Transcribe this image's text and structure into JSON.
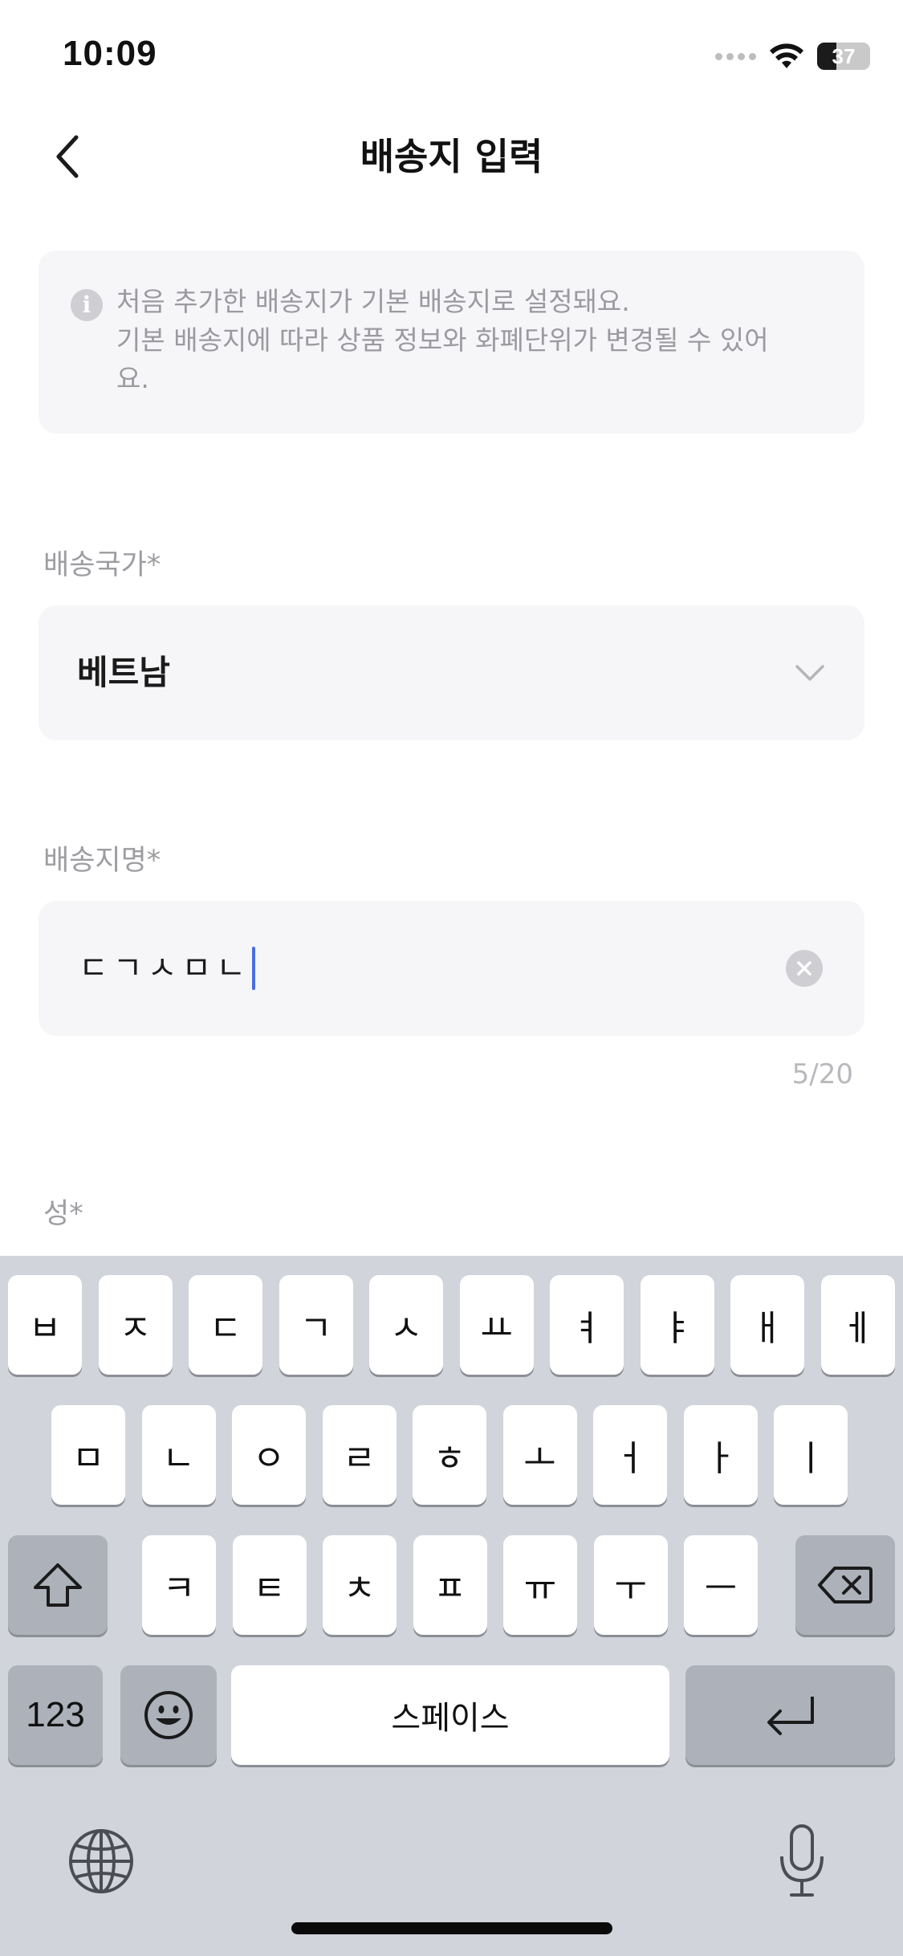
{
  "status_bar": {
    "time": "10:09",
    "battery": "37",
    "battery_level": 0.37,
    "signal_icon": "cellular-dots-icon",
    "wifi_icon": "wifi-icon"
  },
  "nav": {
    "title": "배송지 입력",
    "back_icon": "chevron-left-icon"
  },
  "info": {
    "icon": "info-icon",
    "text": "처음 추가한 배송지가 기본 배송지로 설정돼요.\n기본 배송지에 따라 상품 정보와 화폐단위가 변경될 수 있어\n요."
  },
  "country_field": {
    "label": "배송국가*",
    "value": "베트남",
    "icon": "chevron-down-icon"
  },
  "name_field": {
    "label": "배송지명*",
    "value": "ㄷㄱㅅㅁㄴ",
    "counter": "5/20",
    "clear_icon": "clear-icon"
  },
  "surname_field": {
    "label": "성*"
  },
  "keyboard": {
    "row1": [
      "ㅂ",
      "ㅈ",
      "ㄷ",
      "ㄱ",
      "ㅅ",
      "ㅛ",
      "ㅕ",
      "ㅑ",
      "ㅐ",
      "ㅔ"
    ],
    "row2": [
      "ㅁ",
      "ㄴ",
      "ㅇ",
      "ㄹ",
      "ㅎ",
      "ㅗ",
      "ㅓ",
      "ㅏ",
      "ㅣ"
    ],
    "row3": [
      "ㅋ",
      "ㅌ",
      "ㅊ",
      "ㅍ",
      "ㅠ",
      "ㅜ",
      "ㅡ"
    ],
    "numbers_label": "123",
    "space_label": "스페이스",
    "shift_icon": "shift-icon",
    "delete_icon": "delete-icon",
    "emoji_icon": "emoji-icon",
    "return_icon": "return-icon",
    "globe_icon": "globe-icon",
    "mic_icon": "microphone-icon"
  },
  "colors": {
    "accent_caret": "#4a6ee0",
    "field_bg": "#f6f6f8",
    "keyboard_bg": "#d1d4da"
  }
}
